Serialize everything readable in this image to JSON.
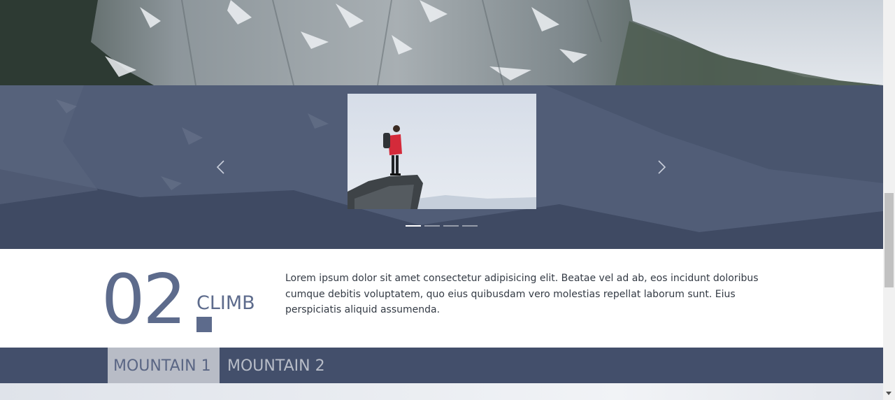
{
  "hero": {
    "image": "snowy-mountain-photo"
  },
  "carousel": {
    "slide_image": "hiker-on-cliff-photo",
    "prev_icon": "chevron-left-icon",
    "next_icon": "chevron-right-icon",
    "indicator_count": 4,
    "active_indicator": 1
  },
  "climb": {
    "number": "02",
    "label": "CLIMB",
    "description": "Lorem ipsum dolor sit amet consectetur adipisicing elit. Beatae vel ad ab, eos incidunt doloribus cumque debitis voluptatem, quo eius quibusdam vero molestias repellat laborum sunt. Eius perspiciatis aliquid assumenda."
  },
  "tabs": [
    {
      "label": "MOUNTAIN 1",
      "active": true
    },
    {
      "label": "MOUNTAIN 2",
      "active": false
    }
  ],
  "colors": {
    "accent": "#5d6b8c",
    "band": "#434f6b",
    "carousel": "#4a5670",
    "active_tab_bg": "#b8bcc6"
  }
}
